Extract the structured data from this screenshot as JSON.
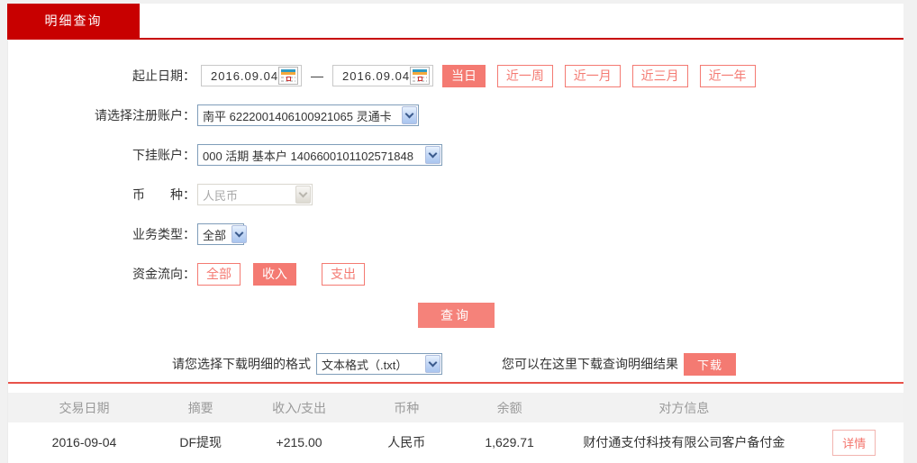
{
  "colors": {
    "tab_red": "#c80000",
    "accent_pink": "#f47a72",
    "separator_red": "#e8524a",
    "amount_red": "#cc0000",
    "header_gray_bg": "#f2f2f2"
  },
  "tab": {
    "label": "明细查询"
  },
  "form": {
    "date_row": {
      "label": "起止日期：",
      "start_value": "2016.09.04",
      "end_value": "2016.09.04",
      "separator": "—",
      "quick_buttons": [
        {
          "label": "当日",
          "active": true
        },
        {
          "label": "近一周",
          "active": false
        },
        {
          "label": "近一月",
          "active": false
        },
        {
          "label": "近三月",
          "active": false
        },
        {
          "label": "近一年",
          "active": false
        }
      ]
    },
    "account_row": {
      "label": "请选择注册账户：",
      "value": "南平 6222001406100921065 灵通卡"
    },
    "sub_account_row": {
      "label": "下挂账户：",
      "value": "000 活期 基本户 1406600101102571848"
    },
    "currency_row": {
      "label": "币　　种：",
      "value": "人民币",
      "disabled": true
    },
    "biz_type_row": {
      "label": "业务类型：",
      "value": "全部"
    },
    "flow_row": {
      "label": "资金流向：",
      "buttons": [
        {
          "label": "全部",
          "active": false
        },
        {
          "label": "收入",
          "active": true
        },
        {
          "label": "支出",
          "active": false
        }
      ]
    },
    "query_button": "查询"
  },
  "download": {
    "format_label": "请您选择下载明细的格式",
    "format_value": "文本格式（.txt）",
    "hint": "您可以在这里下载查询明细结果",
    "button": "下载"
  },
  "table": {
    "headers": [
      "交易日期",
      "摘要",
      "收入/支出",
      "币种",
      "余额",
      "对方信息",
      ""
    ],
    "rows": [
      {
        "date": "2016-09-04",
        "summary": "DF提现",
        "amount": "+215.00",
        "currency": "人民币",
        "balance": "1,629.71",
        "counterparty": "财付通支付科技有限公司客户备付金",
        "action": "详情"
      }
    ]
  }
}
